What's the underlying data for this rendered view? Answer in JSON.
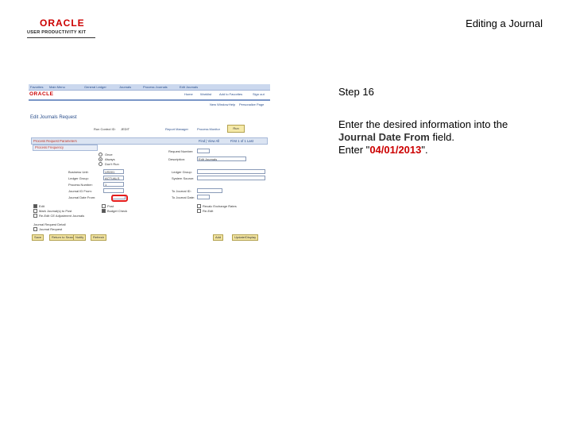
{
  "header": {
    "logo_text": "ORACLE",
    "logo_subtext": "USER PRODUCTIVITY KIT",
    "title": "Editing a Journal"
  },
  "screenshot": {
    "topnav": [
      "Favorites",
      "Main Menu",
      "General Ledger",
      "Journals",
      "Process Journals",
      "Edit Journals"
    ],
    "toplinks": [
      "Home",
      "Worklist",
      "Add to Favorites",
      "Sign out"
    ],
    "app_logo": "ORACLE",
    "links_row": [
      "New Window",
      "Help",
      "Personalize Page"
    ],
    "page_heading": "Edit Journals Request",
    "run_control_label": "Run Control ID:",
    "run_control_value": "JEDIT",
    "report_manager": "Report Manager",
    "process_monitor": "Process Monitor",
    "run_button": "Run",
    "section_title": "Process Request Parameters",
    "section_nav": "Find | View All",
    "section_count": "First 1 of 1 Last",
    "process_frequency": "Process Frequency",
    "freq_options": [
      "Once",
      "Always",
      "Don't Run"
    ],
    "left_fields": [
      {
        "label": "Business Unit:",
        "value": "US001"
      },
      {
        "label": "Ledger Group:",
        "value": "ACTUALS"
      },
      {
        "label": "Process Number:",
        "value": "1"
      },
      {
        "label": "Journal ID From:",
        "value": ""
      },
      {
        "label": "Journal Date From:",
        "value": ""
      }
    ],
    "right_fields": [
      {
        "label": "Request Number:",
        "value": ""
      },
      {
        "label": "Description:",
        "value": "Edit Journals"
      },
      {
        "label": "Ledger Group:",
        "value": ""
      },
      {
        "label": "System Source:",
        "value": ""
      },
      {
        "label": "To Journal ID:",
        "value": ""
      },
      {
        "label": "To Journal Date:",
        "value": ""
      }
    ],
    "checkboxes_left": [
      "Edit",
      "Mark Journal(s) to Post",
      "Re-Edit CE Adjustment Journals"
    ],
    "checkboxes_mid": [
      "Post",
      "Budget Check"
    ],
    "checkboxes_right": [
      "Recalc Exchange Rates",
      "Re-Edit"
    ],
    "foot_link": "Journal Request Detail",
    "foot_check": "Journal Request",
    "buttons_left": [
      "Save",
      "Return to Search",
      "Notify",
      "Refresh"
    ],
    "buttons_right": [
      "Add",
      "Update/Display"
    ]
  },
  "step": {
    "label": "Step 16",
    "line1": "Enter the desired information into the",
    "field_name": "Journal Date From",
    "line2": "field.",
    "enter_prefix": "Enter \"",
    "value": "04/01/2013",
    "enter_suffix": "\"."
  }
}
